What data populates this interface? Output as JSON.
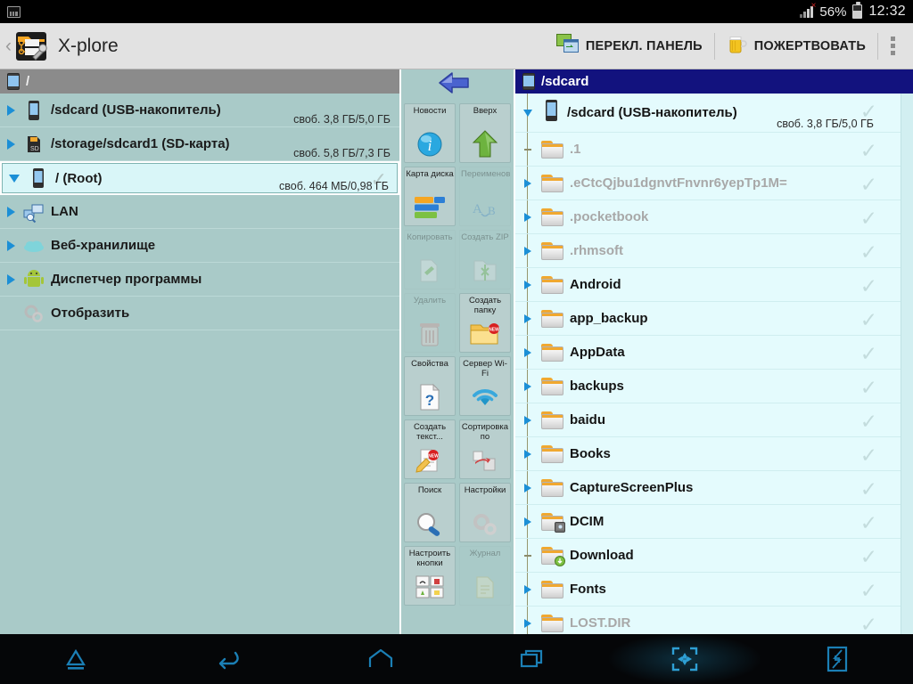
{
  "statusbar": {
    "screenshot_icon": "screenshot-icon",
    "signal_icon": "signal-bars-icon",
    "battery_percent": "56%",
    "battery_icon": "battery-icon",
    "time": "12:32"
  },
  "actionbar": {
    "up_caret": "‹",
    "app_icon": "xplore-app-icon",
    "title": "X-plore",
    "switch_panel": {
      "label": "ПЕРЕКЛ. ПАНЕЛЬ",
      "icon": "switch-panel-icon"
    },
    "donate": {
      "label": "ПОЖЕРТВОВАТЬ",
      "icon": "beer-mug-icon"
    },
    "overflow": "overflow-menu-icon"
  },
  "left_pane": {
    "header": {
      "path": "/",
      "icon": "device-icon",
      "active": false
    },
    "items": [
      {
        "label": "/sdcard (USB-накопитель)",
        "free": "своб. 3,8 ГБ/5,0 ГБ",
        "icon": "device-icon",
        "twisty": "right",
        "selected": false
      },
      {
        "label": "/storage/sdcard1 (SD-карта)",
        "free": "своб. 5,8 ГБ/7,3 ГБ",
        "icon": "sdcard-icon",
        "twisty": "right",
        "selected": false
      },
      {
        "label": "/ (Root)",
        "free": "своб. 464 МБ/0,98 ГБ",
        "icon": "device-icon",
        "twisty": "down",
        "selected": true
      },
      {
        "label": "LAN",
        "free": "",
        "icon": "lan-icon",
        "twisty": "right",
        "selected": false
      },
      {
        "label": "Веб-хранилище",
        "free": "",
        "icon": "cloud-icon",
        "twisty": "right",
        "selected": false
      },
      {
        "label": "Диспетчер программы",
        "free": "",
        "icon": "android-robot-icon",
        "twisty": "right",
        "selected": false
      },
      {
        "label": "Отобразить",
        "free": "",
        "icon": "gears-icon",
        "twisty": "none",
        "selected": false
      }
    ]
  },
  "toolbar": {
    "back_arrow": "back-arrow-icon",
    "buttons": [
      {
        "label": "Новости",
        "icon": "info-icon",
        "enabled": true
      },
      {
        "label": "Вверх",
        "icon": "up-arrow-icon",
        "enabled": true
      },
      {
        "label": "Карта диска",
        "icon": "disk-map-icon",
        "enabled": true
      },
      {
        "label": "Переименовать",
        "icon": "rename-icon",
        "enabled": false
      },
      {
        "label": "Копировать",
        "icon": "copy-icon",
        "enabled": false
      },
      {
        "label": "Создать ZIP",
        "icon": "create-zip-icon",
        "enabled": false
      },
      {
        "label": "Удалить",
        "icon": "trash-icon",
        "enabled": false
      },
      {
        "label": "Создать папку",
        "icon": "new-folder-icon",
        "enabled": true
      },
      {
        "label": "Свойства",
        "icon": "properties-icon",
        "enabled": true
      },
      {
        "label": "Сервер Wi-Fi",
        "icon": "wifi-icon",
        "enabled": true
      },
      {
        "label": "Создать текст...",
        "icon": "new-text-icon",
        "enabled": true
      },
      {
        "label": "Сортировка по",
        "icon": "sort-icon",
        "enabled": true
      },
      {
        "label": "Поиск",
        "icon": "search-icon",
        "enabled": true
      },
      {
        "label": "Настройки",
        "icon": "settings-icon",
        "enabled": true
      },
      {
        "label": "Настроить кнопки",
        "icon": "config-buttons-icon",
        "enabled": true
      },
      {
        "label": "Журнал",
        "icon": "journal-icon",
        "enabled": false
      }
    ]
  },
  "right_pane": {
    "header": {
      "path": "/sdcard",
      "icon": "device-icon",
      "active": true
    },
    "rows": [
      {
        "name": "/sdcard (USB-накопитель)",
        "free": "своб. 3,8 ГБ/5,0 ГБ",
        "type": "device",
        "twisty": "down",
        "dim": false,
        "badge": ""
      },
      {
        "name": ".1",
        "free": "",
        "type": "folder",
        "twisty": "dash",
        "dim": true,
        "badge": ""
      },
      {
        "name": ".eCtcQjbu1dgnvtFnvnr6yepTp1M=",
        "free": "",
        "type": "folder",
        "twisty": "right",
        "dim": true,
        "badge": ""
      },
      {
        "name": ".pocketbook",
        "free": "",
        "type": "folder",
        "twisty": "right",
        "dim": true,
        "badge": ""
      },
      {
        "name": ".rhmsoft",
        "free": "",
        "type": "folder",
        "twisty": "right",
        "dim": true,
        "badge": ""
      },
      {
        "name": "Android",
        "free": "",
        "type": "folder",
        "twisty": "right",
        "dim": false,
        "badge": ""
      },
      {
        "name": "app_backup",
        "free": "",
        "type": "folder",
        "twisty": "right",
        "dim": false,
        "badge": ""
      },
      {
        "name": "AppData",
        "free": "",
        "type": "folder",
        "twisty": "right",
        "dim": false,
        "badge": ""
      },
      {
        "name": "backups",
        "free": "",
        "type": "folder",
        "twisty": "right",
        "dim": false,
        "badge": ""
      },
      {
        "name": "baidu",
        "free": "",
        "type": "folder",
        "twisty": "right",
        "dim": false,
        "badge": ""
      },
      {
        "name": "Books",
        "free": "",
        "type": "folder",
        "twisty": "right",
        "dim": false,
        "badge": ""
      },
      {
        "name": "CaptureScreenPlus",
        "free": "",
        "type": "folder",
        "twisty": "right",
        "dim": false,
        "badge": ""
      },
      {
        "name": "DCIM",
        "free": "",
        "type": "folder",
        "twisty": "right",
        "dim": false,
        "badge": "camera"
      },
      {
        "name": "Download",
        "free": "",
        "type": "folder",
        "twisty": "dash",
        "dim": false,
        "badge": "download"
      },
      {
        "name": "Fonts",
        "free": "",
        "type": "folder",
        "twisty": "right",
        "dim": false,
        "badge": ""
      },
      {
        "name": "LOST.DIR",
        "free": "",
        "type": "folder",
        "twisty": "right",
        "dim": true,
        "badge": ""
      }
    ],
    "row_check_icon": "checkmark-icon"
  },
  "navbar": {
    "items": [
      {
        "icon": "eject-icon",
        "glow": false
      },
      {
        "icon": "back-icon",
        "glow": false
      },
      {
        "icon": "home-icon",
        "glow": false
      },
      {
        "icon": "recents-icon",
        "glow": false
      },
      {
        "icon": "screenshot-nav-icon",
        "glow": true
      },
      {
        "icon": "multiwindow-icon",
        "glow": false
      }
    ]
  },
  "colors": {
    "pane_bg": "#a9cac8",
    "right_bg": "#e4fbfd",
    "active_header": "#12127e",
    "inactive_header": "#8b8b8b",
    "accent_blue": "#1b8fd6",
    "folder_tab": "#f0a830"
  }
}
